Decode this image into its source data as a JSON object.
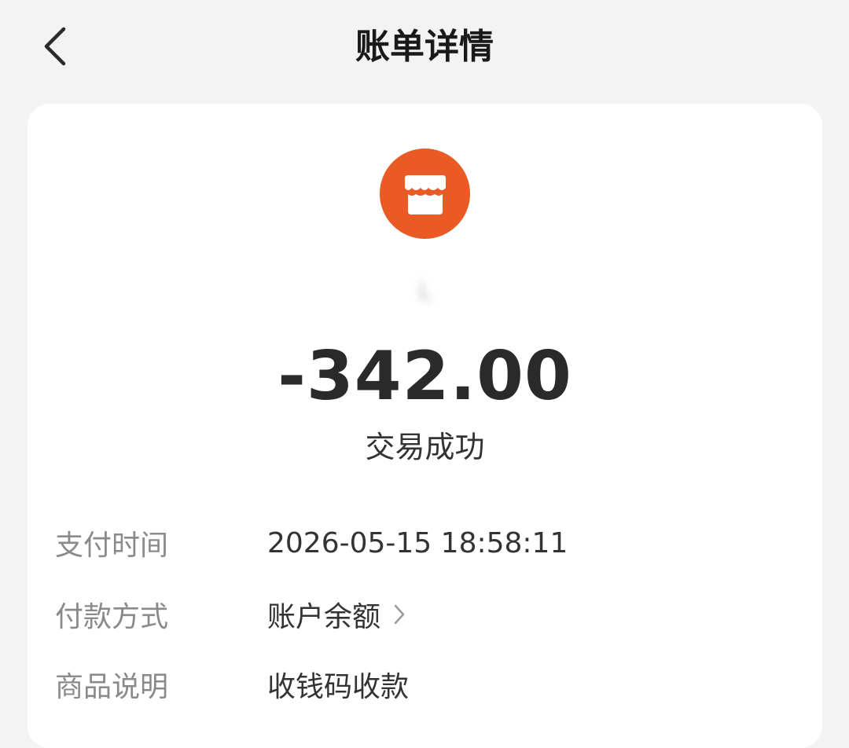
{
  "header": {
    "title": "账单详情",
    "back_icon": "chevron-left-icon"
  },
  "merchant": {
    "icon": "store-icon",
    "icon_color": "#ea5a24",
    "name": "L"
  },
  "transaction": {
    "amount": "-342.00",
    "status": "交易成功"
  },
  "details": {
    "pay_time_label": "支付时间",
    "pay_time_value": "2026-05-15 18:58:11",
    "pay_method_label": "付款方式",
    "pay_method_value": "账户余额",
    "goods_label": "商品说明",
    "goods_value": "收钱码收款"
  }
}
